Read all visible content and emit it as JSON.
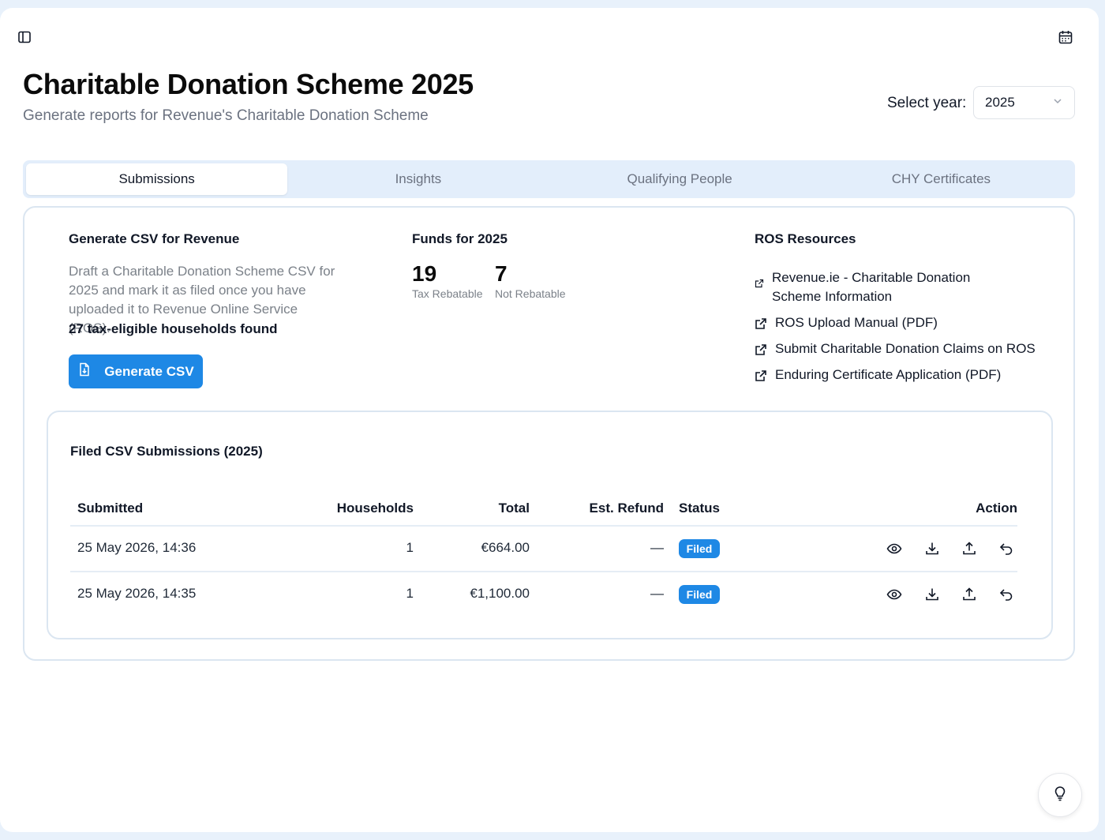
{
  "header": {
    "title": "Charitable Donation Scheme 2025",
    "subtitle": "Generate reports for Revenue's Charitable Donation Scheme",
    "year_label": "Select year:",
    "year_value": "2025"
  },
  "tabs": [
    {
      "label": "Submissions",
      "active": true
    },
    {
      "label": "Insights",
      "active": false
    },
    {
      "label": "Qualifying People",
      "active": false
    },
    {
      "label": "CHY Certificates",
      "active": false
    }
  ],
  "generate": {
    "title": "Generate CSV for Revenue",
    "description": "Draft a Charitable Donation Scheme CSV for 2025 and mark it as filed once you have uploaded it to Revenue Online Service (ROS).",
    "count_text": "27 tax-eligible households found",
    "button_label": "Generate CSV"
  },
  "funds": {
    "title": "Funds for 2025",
    "rebatable_value": "19",
    "rebatable_label": "Tax Rebatable",
    "not_rebatable_value": "7",
    "not_rebatable_label": "Not Rebatable"
  },
  "resources": {
    "title": "ROS Resources",
    "links": [
      "Revenue.ie - Charitable Donation Scheme Information",
      "ROS Upload Manual (PDF)",
      "Submit Charitable Donation Claims on ROS",
      "Enduring Certificate Application (PDF)"
    ]
  },
  "submissions": {
    "title": "Filed CSV Submissions (2025)",
    "columns": {
      "submitted": "Submitted",
      "households": "Households",
      "total": "Total",
      "refund": "Est. Refund",
      "status": "Status",
      "action": "Action"
    },
    "rows": [
      {
        "submitted": "25 May 2026, 14:36",
        "households": "1",
        "total": "€664.00",
        "refund": "—",
        "status": "Filed"
      },
      {
        "submitted": "25 May 2026, 14:35",
        "households": "1",
        "total": "€1,100.00",
        "refund": "—",
        "status": "Filed"
      }
    ]
  },
  "colors": {
    "accent": "#1e88e5",
    "tab_bg": "#e3eefb",
    "page_bg": "#e8f1fb"
  },
  "icons": {
    "sidebar": "sidebar-toggle-icon",
    "calendar": "calendar-icon",
    "help": "lightbulb-icon",
    "external": "external-link-icon",
    "actions": [
      "eye-icon",
      "download-icon",
      "upload-icon",
      "undo-icon"
    ]
  }
}
